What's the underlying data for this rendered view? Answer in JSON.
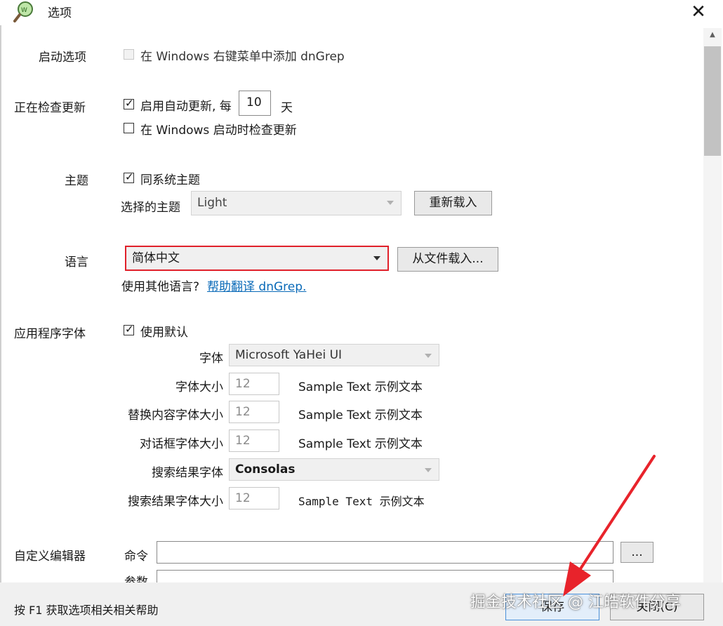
{
  "window": {
    "title": "选项",
    "close_glyph": "✕"
  },
  "startup": {
    "label": "启动选项",
    "shell_menu_label": "在 Windows 右键菜单中添加 dnGrep"
  },
  "updates": {
    "label": "正在检查更新",
    "auto_update_label": "启用自动更新, 每",
    "interval_value": "10",
    "interval_unit": "天",
    "startup_check_label": "在 Windows 启动时检查更新"
  },
  "theme": {
    "label": "主题",
    "follow_system_label": "同系统主题",
    "selected_label": "选择的主题",
    "selected_value": "Light",
    "reload_button": "重新载入"
  },
  "language": {
    "label": "语言",
    "selected_value": "简体中文",
    "load_from_file_button": "从文件载入...",
    "other_prompt": "使用其他语言?",
    "help_link": "帮助翻译 dnGrep."
  },
  "fonts": {
    "label": "应用程序字体",
    "use_default_label": "使用默认",
    "font_label": "字体",
    "font_value": "Microsoft YaHei UI",
    "size_label": "字体大小",
    "size_value": "12",
    "replace_size_label": "替换内容字体大小",
    "replace_size_value": "12",
    "dialog_size_label": "对话框字体大小",
    "dialog_size_value": "12",
    "results_font_label": "搜索结果字体",
    "results_font_value": "Consolas",
    "results_size_label": "搜索结果字体大小",
    "results_size_value": "12",
    "sample_text": "Sample Text 示例文本"
  },
  "editor": {
    "label": "自定义编辑器",
    "command_label": "命令",
    "command_value": "",
    "browse_button": "...",
    "args_label": "参数"
  },
  "footer": {
    "help_hint": "按 F1 获取选项相关相关帮助",
    "save_button": "保存",
    "close_button": "关闭(C)"
  },
  "watermark": {
    "text": "掘金技术社区 @ 江皓软件分享"
  },
  "colors": {
    "accent_border": "#e0202a",
    "link": "#0a6ab8",
    "arrow": "#e8232b"
  }
}
